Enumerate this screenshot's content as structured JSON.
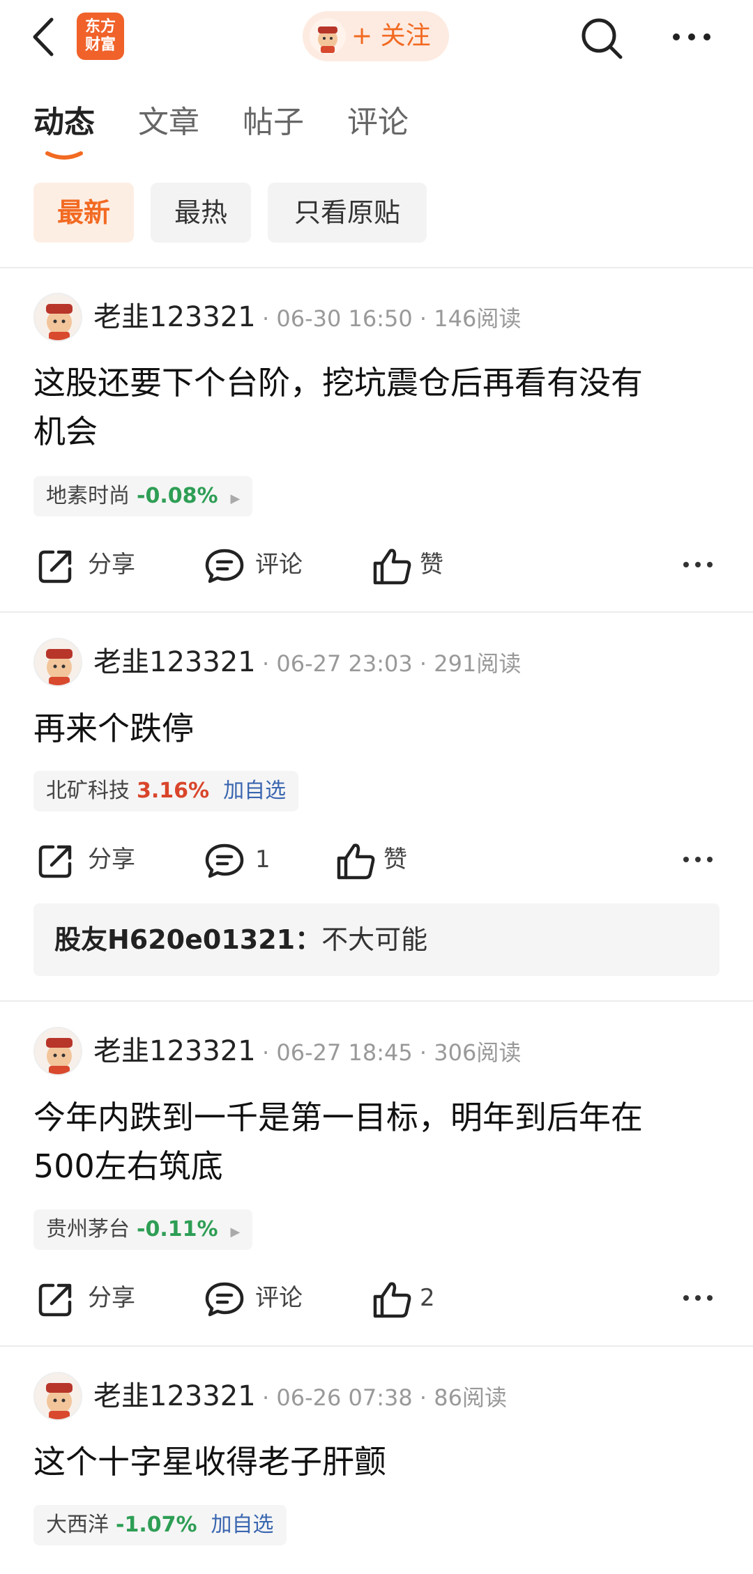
{
  "header": {
    "logo_line1": "东方",
    "logo_line2": "财富",
    "follow_label": "+ 关注"
  },
  "tabs": [
    {
      "label": "动态",
      "active": true
    },
    {
      "label": "文章",
      "active": false
    },
    {
      "label": "帖子",
      "active": false
    },
    {
      "label": "评论",
      "active": false
    }
  ],
  "filters": [
    {
      "label": "最新",
      "active": true
    },
    {
      "label": "最热",
      "active": false
    },
    {
      "label": "只看原贴",
      "active": false
    }
  ],
  "posts": [
    {
      "user": "老韭123321",
      "meta": "· 06-30 16:50 · 146阅读",
      "content_line1": "这股还要下个台阶，挖坑震仓后再看有没有",
      "content_line2": "机会",
      "stock": {
        "name": "地素时尚",
        "change": "-0.08%",
        "add": ""
      },
      "actions": {
        "share": "分享",
        "comment": "评论",
        "like": "赞"
      }
    },
    {
      "user": "老韭123321",
      "meta": "· 06-27 23:03 · 291阅读",
      "content_line1": "再来个跌停",
      "content_line2": "",
      "stock": {
        "name": "北矿科技",
        "change": "3.16%",
        "add": "加自选"
      },
      "actions": {
        "share": "分享",
        "comment": "1",
        "like": "赞"
      },
      "reply": {
        "author": "股友H620e01321：",
        "text": "不大可能"
      }
    },
    {
      "user": "老韭123321",
      "meta": "· 06-27 18:45 · 306阅读",
      "content_line1": "今年内跌到一千是第一目标，明年到后年在",
      "content_line2": "500左右筑底",
      "stock": {
        "name": "贵州茅台",
        "change": "-0.11%",
        "add": ""
      },
      "actions": {
        "share": "分享",
        "comment": "评论",
        "like": "2"
      }
    },
    {
      "user": "老韭123321",
      "meta": "· 06-26 07:38 · 86阅读",
      "content_line1": "这个十字星收得老子肝颤",
      "content_line2": "",
      "stock": {
        "name": "大西洋",
        "change": "-1.07%",
        "add": "加自选"
      }
    }
  ]
}
